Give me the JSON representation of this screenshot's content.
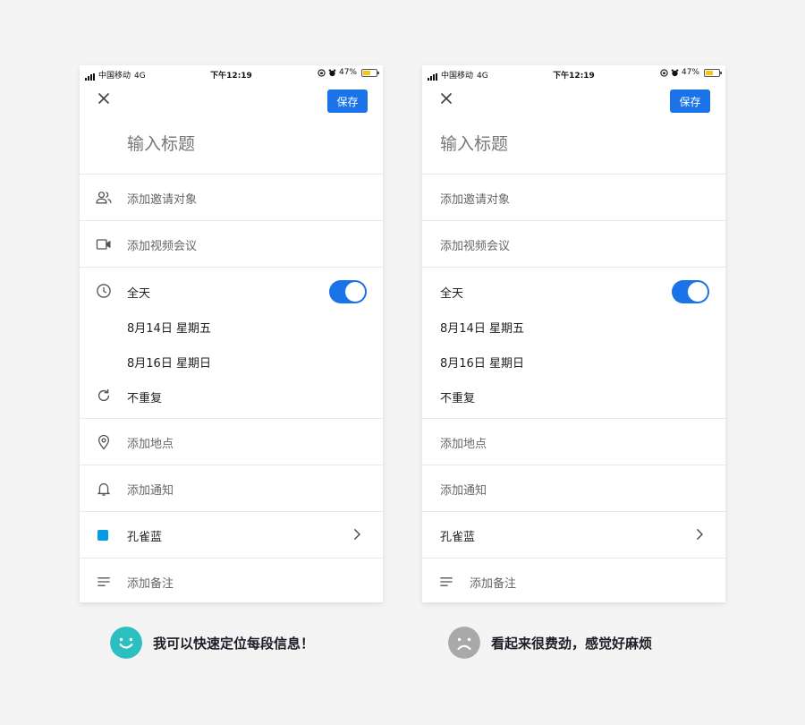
{
  "colors": {
    "accent": "#1a73e8",
    "swatch": "#039be5",
    "happy_face": "#2bbfbf",
    "sad_face": "#a9a9a9",
    "battery": "#f5c518"
  },
  "phones": [
    {
      "status": {
        "carrier": "中国移动",
        "network": "4G",
        "time": "下午12:19",
        "battery": "47%"
      },
      "save_label": "保存",
      "title_placeholder": "输入标题",
      "rows": {
        "invite": "添加邀请对象",
        "video": "添加视频会议",
        "allday": "全天",
        "start": "8月14日 星期五",
        "end": "8月16日 星期日",
        "repeat": "不重复",
        "location": "添加地点",
        "notify": "添加通知",
        "color": "孔雀蓝",
        "note": "添加备注"
      }
    },
    {
      "status": {
        "carrier": "中国移动",
        "network": "4G",
        "time": "下午12:19",
        "battery": "47%"
      },
      "save_label": "保存",
      "title_placeholder": "输入标题",
      "rows": {
        "invite": "添加邀请对象",
        "video": "添加视频会议",
        "allday": "全天",
        "start": "8月14日 星期五",
        "end": "8月16日 星期日",
        "repeat": "不重复",
        "location": "添加地点",
        "notify": "添加通知",
        "color": "孔雀蓝",
        "note": "添加备注"
      }
    }
  ],
  "captions": {
    "left": "我可以快速定位每段信息！",
    "right": "看起来很费劲，感觉好麻烦"
  }
}
